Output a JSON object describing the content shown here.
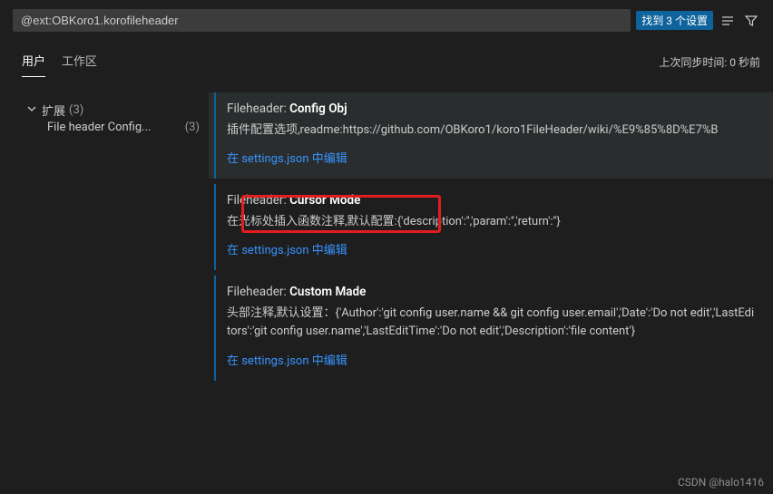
{
  "search": {
    "value": "@ext:OBKoro1.korofileheader",
    "found_badge": "找到 3 个设置"
  },
  "tabs": {
    "user": "用户",
    "workspace": "工作区"
  },
  "sync_label": "上次同步时间: 0 秒前",
  "tree": {
    "root_label": "扩展",
    "root_count": "(3)",
    "child_label": "File header Config...",
    "child_count": "(3)"
  },
  "settings": [
    {
      "prefix": "Fileheader: ",
      "name": "Config Obj",
      "desc": "插件配置选项,readme:https://github.com/OBKoro1/koro1FileHeader/wiki/%E9%85%8D%E7%B",
      "edit": "在 settings.json 中编辑"
    },
    {
      "prefix": "Fileheader: ",
      "name": "Cursor Mode",
      "desc": "在光标处插入函数注释,默认配置:{'description':'','param':'','return':''}",
      "edit": "在 settings.json 中编辑"
    },
    {
      "prefix": "Fileheader: ",
      "name": "Custom Made",
      "desc": "头部注释,默认设置：{'Author':'git config user.name && git config user.email','Date':'Do not edit','LastEditors':'git config user.name','LastEditTime':'Do not edit','Description':'file content'}",
      "edit": "在 settings.json 中编辑"
    }
  ],
  "watermark": "CSDN @halo1416"
}
